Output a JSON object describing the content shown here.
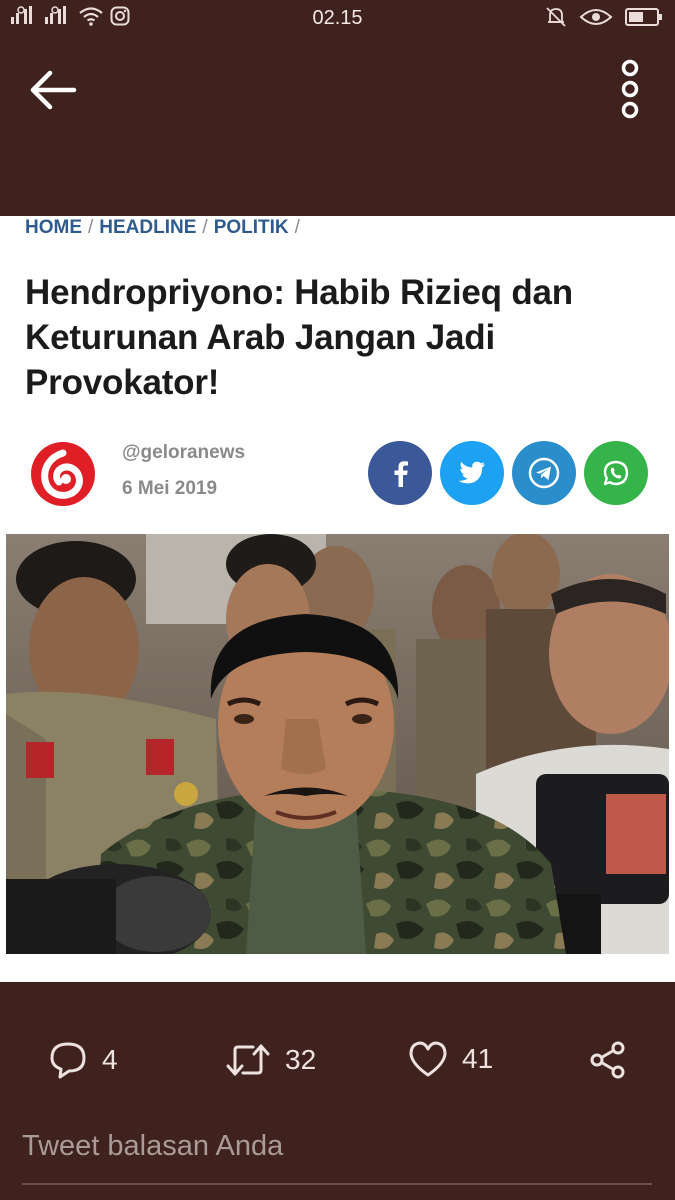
{
  "status_bar": {
    "time": "02.15",
    "icons": [
      "signal-icon",
      "signal-icon",
      "wifi-icon",
      "instagram-icon",
      "mute-icon",
      "eye-icon",
      "battery-icon"
    ]
  },
  "app_bar": {
    "back_icon": "arrow-left-icon",
    "menu_icon": "more-vertical-icon"
  },
  "article": {
    "breadcrumb": [
      "HOME",
      "HEADLINE",
      "POLITIK"
    ],
    "breadcrumb_separator": "/",
    "title": "Hendropriyono: Habib Rizieq dan Keturunan Arab Jangan Jadi Provokator!",
    "author": "@geloranews",
    "date": "6 Mei 2019",
    "share_buttons": [
      "facebook-icon",
      "twitter-icon",
      "telegram-icon",
      "whatsapp-icon"
    ],
    "colors": {
      "facebook": "#3b5998",
      "twitter": "#1da1f2",
      "telegram": "#2b8ecc",
      "whatsapp": "#34b449",
      "link": "#2f5b8f"
    }
  },
  "tweet_actions": {
    "replies": "4",
    "retweets": "32",
    "likes": "41"
  },
  "reply": {
    "placeholder": "Tweet balasan Anda"
  },
  "theme": {
    "background": "#3f221e",
    "card": "#ffffff"
  }
}
